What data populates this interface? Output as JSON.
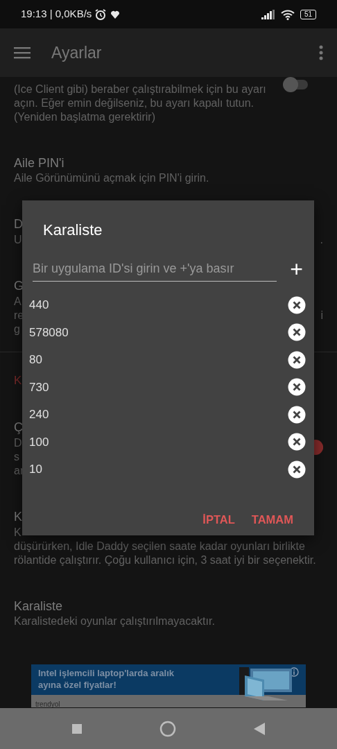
{
  "status_bar": {
    "time": "19:13 | 0,0KB/s",
    "battery": "51"
  },
  "app_bar": {
    "title": "Ayarlar"
  },
  "settings": [
    {
      "kind": "paragraph_toggle",
      "summary": "(Ice Client gibi) beraber çalıştırabilmek için bu ayarı açın. Eğer emin değilseniz, bu ayarı kapalı tutun. (Yeniden başlatma gerektirir)",
      "on": false
    },
    {
      "kind": "item",
      "title": "Aile PIN'i",
      "summary": "Aile Görünümünü açmak için PIN'i girin."
    },
    {
      "kind": "covered",
      "title": "D",
      "lines": [
        {
          "left": "U",
          "right": "."
        }
      ]
    },
    {
      "kind": "covered",
      "title": "G",
      "lines": [
        {
          "left": "A"
        },
        {
          "left": "re",
          "right": "i"
        },
        {
          "left": "g"
        }
      ]
    },
    {
      "kind": "header",
      "title": "K"
    },
    {
      "kind": "covered",
      "title": "Ç",
      "lines": [
        {
          "left": "D"
        },
        {
          "left": "s"
        },
        {
          "left": "ar"
        }
      ],
      "on": true
    },
    {
      "kind": "covered",
      "title": "K",
      "lines": [
        {
          "left": "K"
        }
      ],
      "tail": "düşürürken, Idle Daddy seçilen saate kadar oyunları birlikte rölantide çalıştırır. Çoğu kullanıcı için, 3 saat iyi bir seçenektir."
    },
    {
      "kind": "item",
      "title": "Karaliste",
      "summary": "Karalistedeki oyunlar çalıştırılmayacaktır."
    }
  ],
  "ad": {
    "headline": "Intel işlemcili laptop'larda aralık ayına özel fiyatlar!",
    "brand": "trendyol"
  },
  "dialog": {
    "title": "Karaliste",
    "placeholder": "Bir uygulama ID'si girin ve +'ya basır",
    "add": "+",
    "items": [
      {
        "id": "440"
      },
      {
        "id": "578080"
      },
      {
        "id": "80"
      },
      {
        "id": "730"
      },
      {
        "id": "240"
      },
      {
        "id": "100"
      },
      {
        "id": "10"
      }
    ],
    "buttons": [
      "İPTAL",
      "TAMAM"
    ]
  }
}
